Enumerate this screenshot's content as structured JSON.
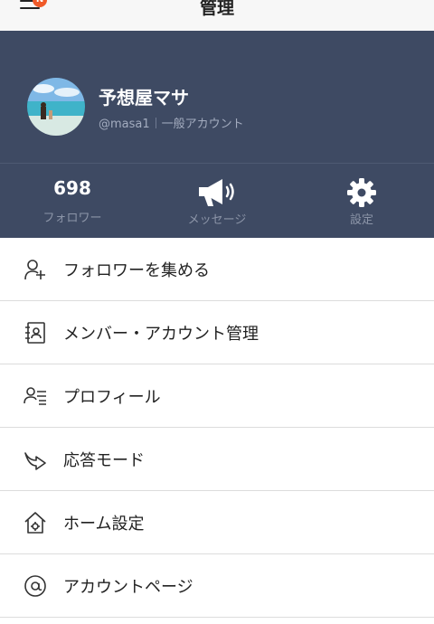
{
  "topbar": {
    "title": "管理",
    "menu_badge": "N"
  },
  "profile": {
    "name": "予想屋マサ",
    "handle": "@masa1",
    "account_type": "一般アカウント"
  },
  "stats": {
    "followers_count": "698",
    "followers_label": "フォロワー",
    "messages_label": "メッセージ",
    "settings_label": "設定"
  },
  "menu": {
    "items": [
      {
        "label": "フォロワーを集める",
        "icon": "add-user-icon"
      },
      {
        "label": "メンバー・アカウント管理",
        "icon": "contact-book-icon"
      },
      {
        "label": "プロフィール",
        "icon": "profile-card-icon"
      },
      {
        "label": "応答モード",
        "icon": "reply-arrow-icon"
      },
      {
        "label": "ホーム設定",
        "icon": "home-gear-icon"
      },
      {
        "label": "アカウントページ",
        "icon": "at-sign-icon"
      }
    ]
  },
  "colors": {
    "header_bg": "#3e4a63",
    "badge": "#f05a28"
  }
}
